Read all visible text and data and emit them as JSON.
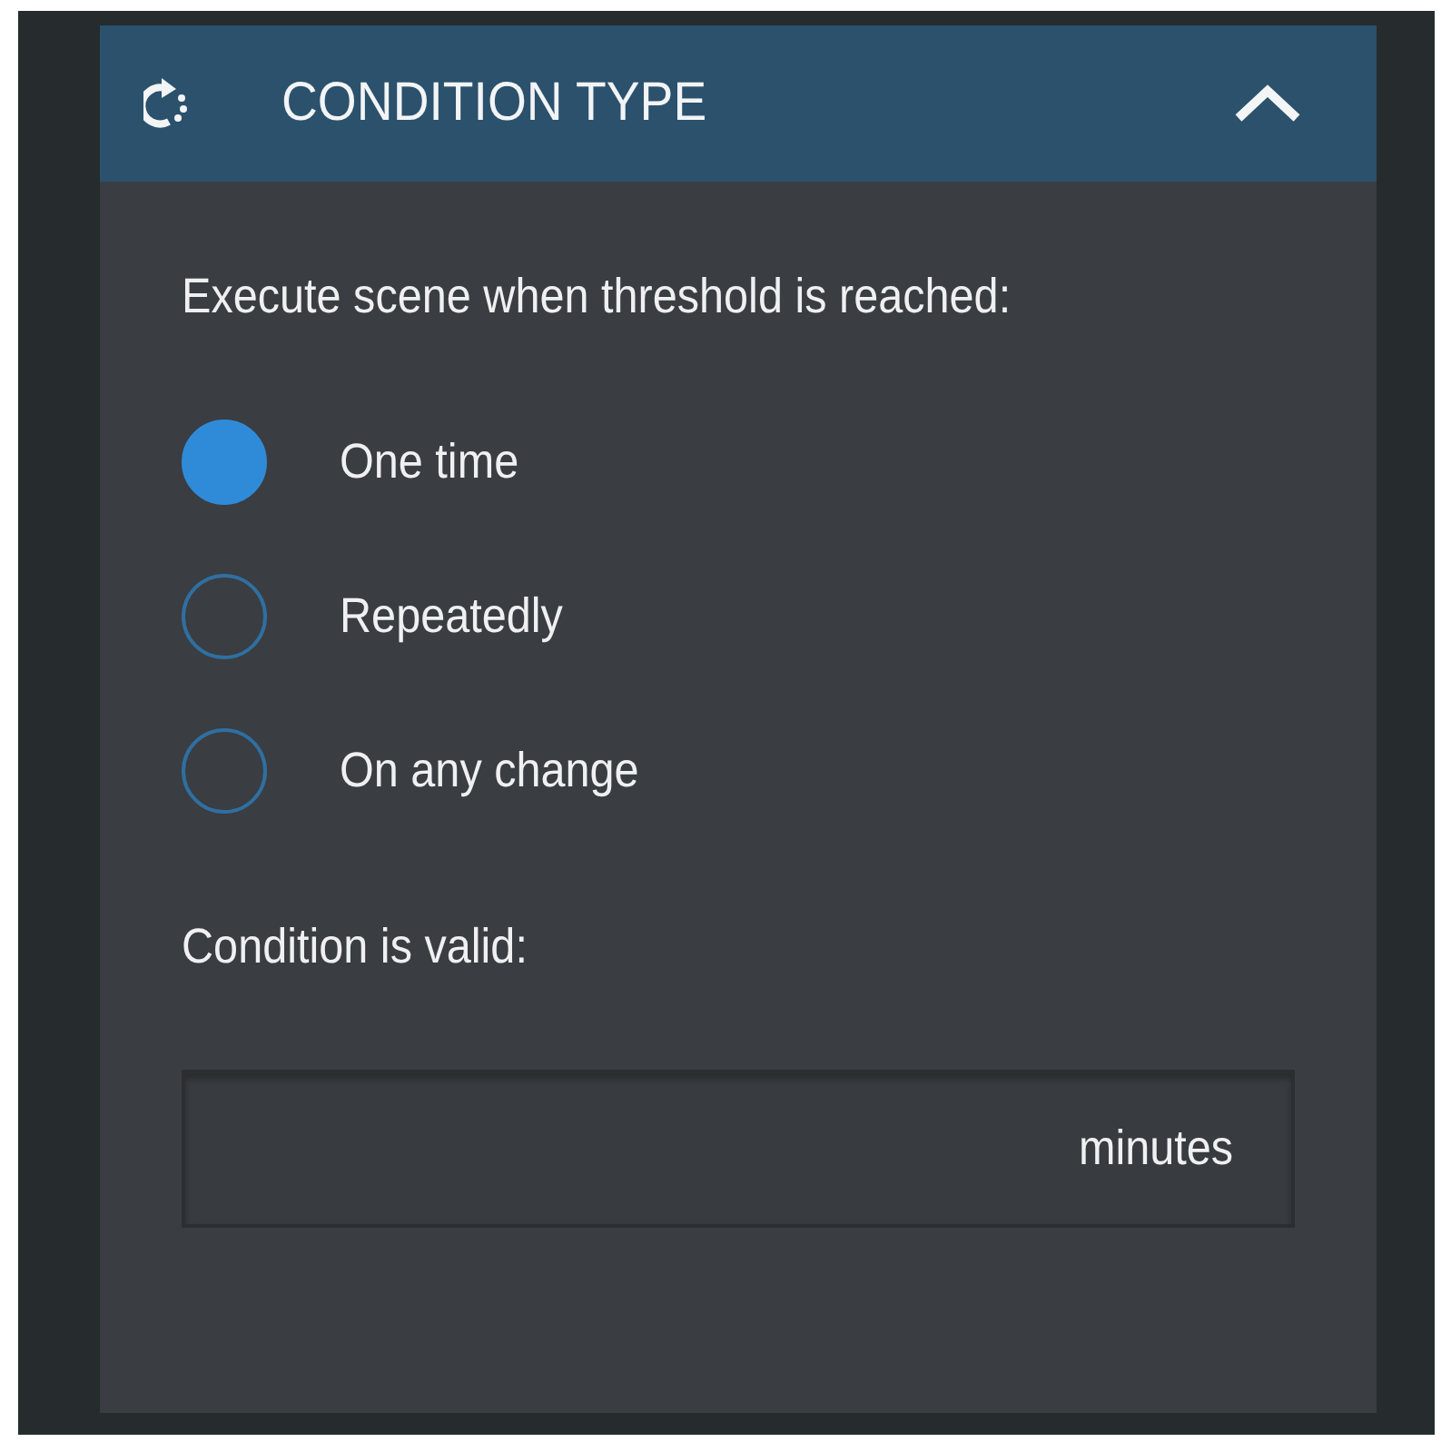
{
  "panel": {
    "title": "CONDITION TYPE",
    "expanded": true
  },
  "prompt": "Execute scene when threshold is reached:",
  "options": [
    {
      "label": "One time",
      "selected": true
    },
    {
      "label": "Repeatedly",
      "selected": false
    },
    {
      "label": "On any change",
      "selected": false
    }
  ],
  "validity": {
    "label": "Condition is valid:",
    "unit": "minutes"
  }
}
